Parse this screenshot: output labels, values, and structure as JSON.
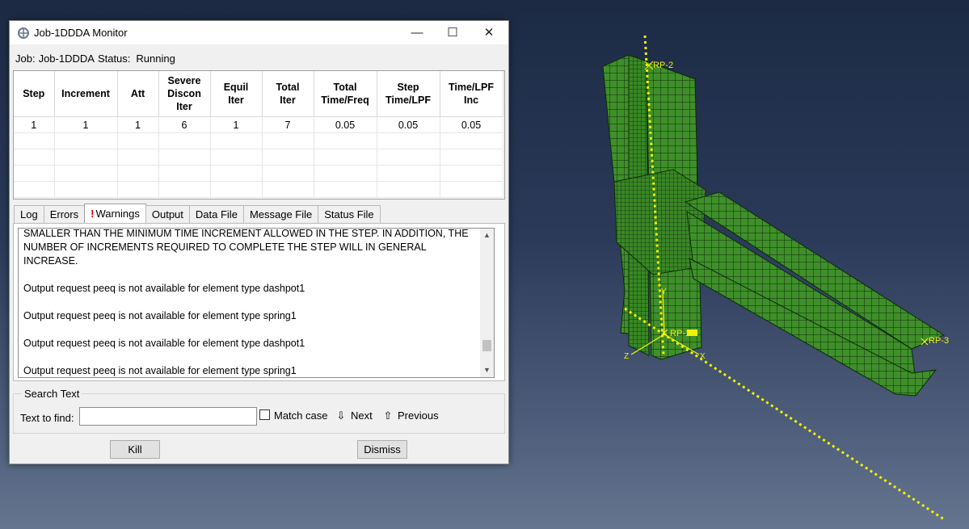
{
  "window": {
    "title": "Job-1DDDA Monitor",
    "minimize_glyph": "—",
    "maximize_glyph": "☐",
    "close_glyph": "✕"
  },
  "job_line": {
    "job_label": "Job:",
    "job_name": "Job-1DDDA",
    "status_label": "Status:",
    "status_value": "Running"
  },
  "table": {
    "columns": [
      [
        "Step"
      ],
      [
        "Increment"
      ],
      [
        "Att"
      ],
      [
        "Severe",
        "Discon",
        "Iter"
      ],
      [
        "Equil",
        "Iter"
      ],
      [
        "Total",
        "Iter"
      ],
      [
        "Total",
        "Time/Freq"
      ],
      [
        "Step",
        "Time/LPF"
      ],
      [
        "Time/LPF",
        "Inc"
      ]
    ],
    "rows": [
      [
        "1",
        "1",
        "1",
        "6",
        "1",
        "7",
        "0.05",
        "0.05",
        "0.05"
      ],
      [
        "",
        "",
        "",
        "",
        "",
        "",
        "",
        "",
        ""
      ],
      [
        "",
        "",
        "",
        "",
        "",
        "",
        "",
        "",
        ""
      ],
      [
        "",
        "",
        "",
        "",
        "",
        "",
        "",
        "",
        ""
      ],
      [
        "",
        "",
        "",
        "",
        "",
        "",
        "",
        "",
        ""
      ]
    ]
  },
  "tabs": [
    "Log",
    "Errors",
    "Warnings",
    "Output",
    "Data File",
    "Message File",
    "Status File"
  ],
  "active_tab": "Warnings",
  "warning_glyph": "!",
  "log_lines": [
    "SMALLER THAN THE MINIMUM TIME INCREMENT ALLOWED IN THE STEP. IN ADDITION, THE NUMBER OF INCREMENTS REQUIRED TO COMPLETE THE STEP WILL IN GENERAL INCREASE.",
    "Output request peeq is not available for element type dashpot1",
    "Output request peeq is not available for element type spring1",
    "Output request peeq is not available for element type dashpot1",
    "Output request peeq is not available for element type spring1"
  ],
  "search": {
    "legend": "Search Text",
    "label": "Text to find:",
    "value": "",
    "match_case_label": "Match case",
    "next_label": "Next",
    "previous_label": "Previous"
  },
  "buttons": {
    "kill": "Kill",
    "dismiss": "Dismiss"
  },
  "viewport": {
    "rp_labels": [
      "RP-2",
      "RP-1",
      "RP-3"
    ],
    "axis_labels": [
      "Y",
      "Z",
      "X"
    ],
    "model_color": "#2f7d1e",
    "line_color": "#f2f200"
  }
}
